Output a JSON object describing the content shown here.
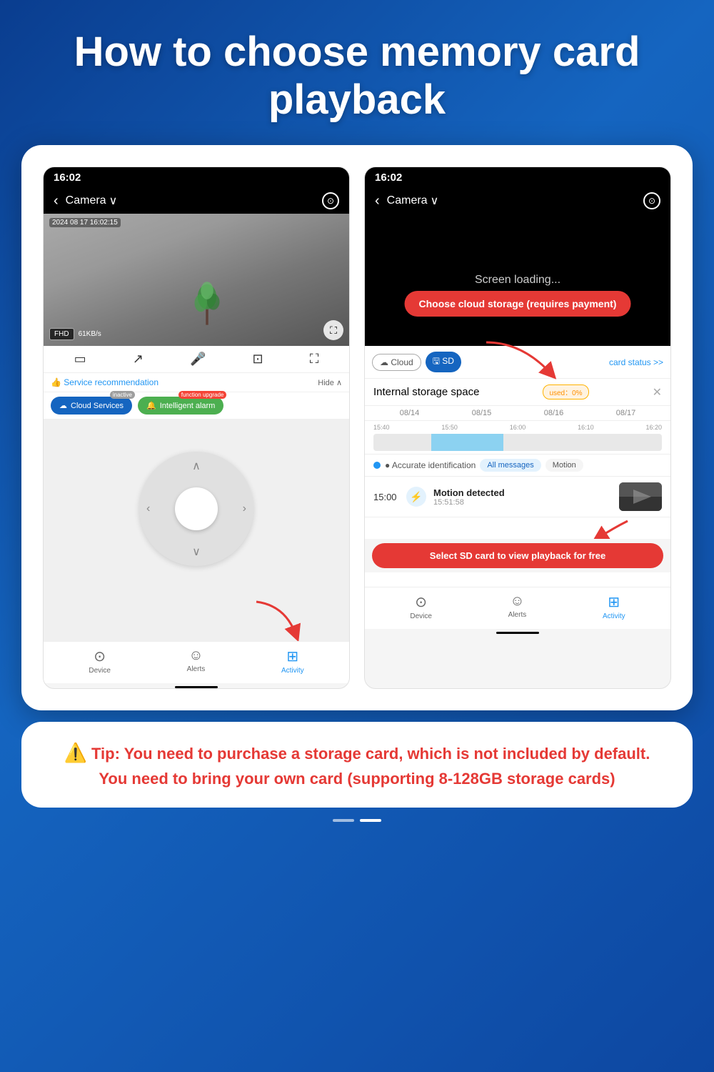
{
  "header": {
    "title": "How to choose memory card playback"
  },
  "left_screen": {
    "statusbar_time": "16:02",
    "camera_title": "Camera",
    "timestamp": "2024 08 17 16:02:15",
    "fhd_label": "FHD",
    "speed_label": "61KB/s",
    "service_rec_label": "👍 Service recommendation",
    "hide_label": "Hide ∧",
    "cloud_services_label": "Cloud Services",
    "cloud_inactive_badge": "inactive",
    "alarm_label": "Intelligent alarm",
    "alarm_upgrade_badge": "function upgrade",
    "nav_device": "Device",
    "nav_alerts": "Alerts",
    "nav_activity": "Activity"
  },
  "right_screen": {
    "statusbar_time": "16:02",
    "camera_title": "Camera",
    "screen_loading": "Screen loading...",
    "cloud_callout": "Choose cloud storage (requires payment)",
    "tab_cloud": "☁ Cloud",
    "tab_sd": "🖫 SD",
    "card_status": "card status >>",
    "storage_title": "Internal storage space",
    "used_label": "used：0%",
    "dates": [
      "08/14",
      "08/15",
      "08/16",
      "08/17"
    ],
    "times": [
      "15:40",
      "15:50",
      "16:00",
      "16:10",
      "16:20"
    ],
    "filter_label": "● Accurate identification",
    "tag_all": "All messages",
    "tag_motion": "Motion",
    "event_time": "15:00",
    "event_title": "Motion detected",
    "event_subtitle": "15:51:58",
    "sd_callout": "Select SD card to view playback for free",
    "nav_device": "Device",
    "nav_alerts": "Alerts",
    "nav_activity": "Activity"
  },
  "tip": {
    "icon": "⚠️",
    "text": "Tip: You need to purchase a storage card, which is not included by default. You need to bring your own card (supporting 8-128GB storage cards)"
  },
  "pagination": {
    "dots": [
      "inactive",
      "active"
    ]
  }
}
